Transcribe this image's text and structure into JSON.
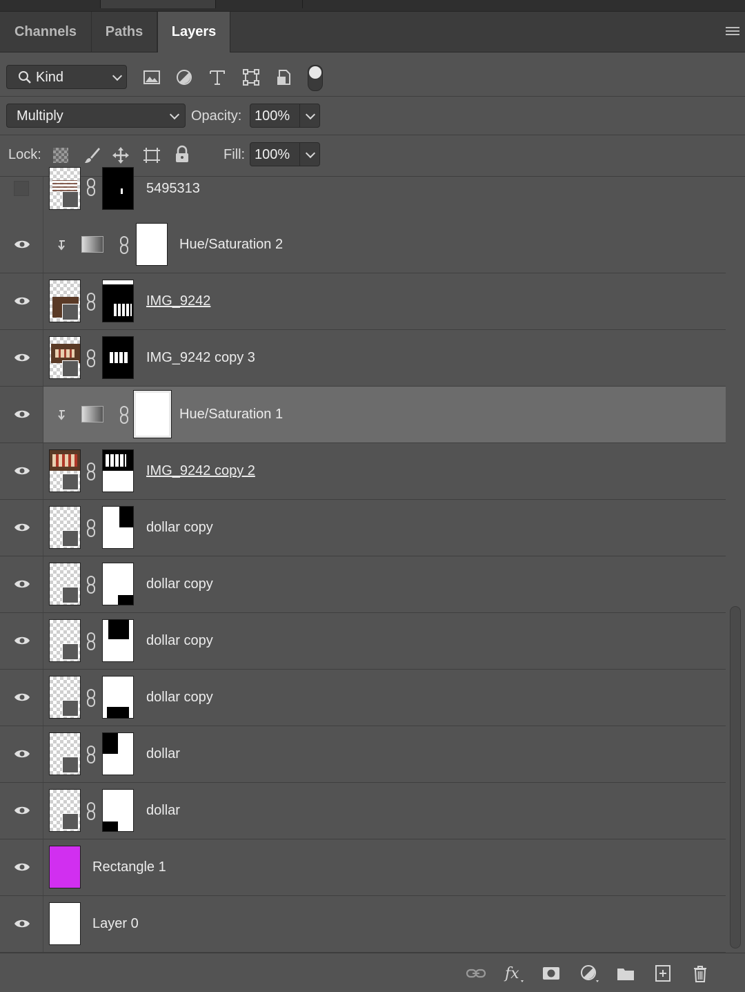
{
  "tabs": [
    {
      "label": "Channels",
      "active": false
    },
    {
      "label": "Paths",
      "active": false
    },
    {
      "label": "Layers",
      "active": true
    }
  ],
  "filter": {
    "kind_label": "Kind"
  },
  "blend": {
    "mode": "Multiply",
    "opacity_label": "Opacity:",
    "opacity_value": "100%"
  },
  "lock": {
    "label": "Lock:",
    "fill_label": "Fill:",
    "fill_value": "100%"
  },
  "layers": [
    {
      "name": "5495313",
      "visible": false,
      "kind": "smart",
      "underline": false
    },
    {
      "name": "Hue/Saturation 2",
      "visible": true,
      "kind": "adjustment",
      "clipped": true
    },
    {
      "name": "IMG_9242",
      "visible": true,
      "kind": "smart",
      "underline": true
    },
    {
      "name": "IMG_9242 copy 3",
      "visible": true,
      "kind": "smart",
      "underline": false
    },
    {
      "name": "Hue/Saturation 1",
      "visible": true,
      "kind": "adjustment",
      "clipped": true,
      "selected": true
    },
    {
      "name": "IMG_9242 copy 2",
      "visible": true,
      "kind": "smart",
      "underline": true
    },
    {
      "name": "dollar copy",
      "visible": true,
      "kind": "smart"
    },
    {
      "name": "dollar copy",
      "visible": true,
      "kind": "smart"
    },
    {
      "name": "dollar copy",
      "visible": true,
      "kind": "smart"
    },
    {
      "name": "dollar copy",
      "visible": true,
      "kind": "smart"
    },
    {
      "name": "dollar",
      "visible": true,
      "kind": "smart"
    },
    {
      "name": "dollar",
      "visible": true,
      "kind": "smart"
    },
    {
      "name": "Rectangle 1",
      "visible": true,
      "kind": "shape",
      "color": "#d12ff0"
    },
    {
      "name": "Layer 0",
      "visible": true,
      "kind": "pixel",
      "color": "#ffffff"
    }
  ],
  "colors": {
    "panel": "#535353",
    "selected_row": "#6c6c6c",
    "rectangle_fill": "#d12ff0"
  }
}
